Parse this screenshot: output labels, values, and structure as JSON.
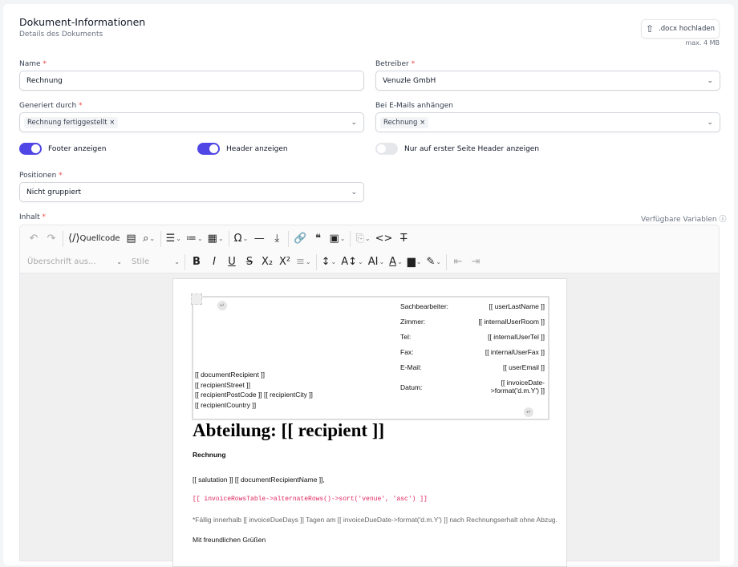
{
  "header": {
    "title": "Dokument-Informationen",
    "subtitle": "Details des Dokuments",
    "upload_label": ".docx hochladen",
    "upload_hint": "max. 4 MB"
  },
  "form": {
    "name": {
      "label": "Name",
      "value": "Rechnung"
    },
    "betreiber": {
      "label": "Betreiber",
      "value": "Venuzle GmbH"
    },
    "generiert": {
      "label": "Generiert durch",
      "chip": "Rechnung fertiggestellt"
    },
    "email": {
      "label": "Bei E-Mails anhängen",
      "chip": "Rechnung"
    },
    "toggles": [
      {
        "label": "Footer anzeigen",
        "on": true
      },
      {
        "label": "Header anzeigen",
        "on": true
      },
      {
        "label": "Nur auf erster Seite Header anzeigen",
        "on": false
      }
    ],
    "positionen": {
      "label": "Positionen",
      "value": "Nicht gruppiert"
    },
    "inhalt": {
      "label": "Inhalt",
      "variables_link": "Verfügbare Variablen"
    }
  },
  "toolbar": {
    "row1": [
      "undo",
      "redo",
      "|",
      "source-code",
      "select-all",
      "find-replace",
      "|",
      "bullet-list",
      "numbered-list",
      "table",
      "|",
      "special-char",
      "horizontal-line",
      "page-break",
      "|",
      "link",
      "blockquote",
      "image",
      "|",
      "template",
      "code",
      "clear-format"
    ],
    "source_label": "Quellcode",
    "heading_select": "Überschrift aus...",
    "styles_select": "Stile",
    "row2": [
      "bold",
      "italic",
      "underline",
      "strikethrough",
      "subscript",
      "superscript",
      "align",
      "|",
      "line-height",
      "font-size",
      "font-family",
      "font-color",
      "background-color",
      "highlight",
      "|",
      "outdent",
      "indent"
    ]
  },
  "document": {
    "address": [
      "[[ documentRecipient ]]",
      "[[ recipientStreet ]]",
      "[[ recipientPostCode ]] [[ recipientCity ]]",
      "[[ recipientCountry ]]"
    ],
    "info": [
      {
        "k": "Sachbearbeiter:",
        "v": "[[ userLastName ]]"
      },
      {
        "k": "Zimmer:",
        "v": "[[ internalUserRoom ]]"
      },
      {
        "k": "Tel:",
        "v": "[[ internalUserTel ]]"
      },
      {
        "k": "Fax:",
        "v": "[[ internalUserFax ]]"
      },
      {
        "k": "E-Mail:",
        "v": "[[ userEmail ]]"
      },
      {
        "k": "Datum:",
        "v": "[[ invoiceDate->format('d.m.Y') ]]"
      }
    ],
    "heading": "Abteilung: [[ recipient ]]",
    "subject": "Rechnung",
    "salutation": "[[ salutation ]] [[ documentRecipientName ]],",
    "table_code": "[[ invoiceRowsTable->alternateRows()->sort('venue', 'asc') ]]",
    "due_note": "*Fällig innerhalb [[ invoiceDueDays ]] Tagen am [[ invoiceDueDate->format('d.m.Y') ]] nach Rechnungserhalt ohne Abzug.",
    "closing": "Mit freundlichen Grüßen"
  }
}
